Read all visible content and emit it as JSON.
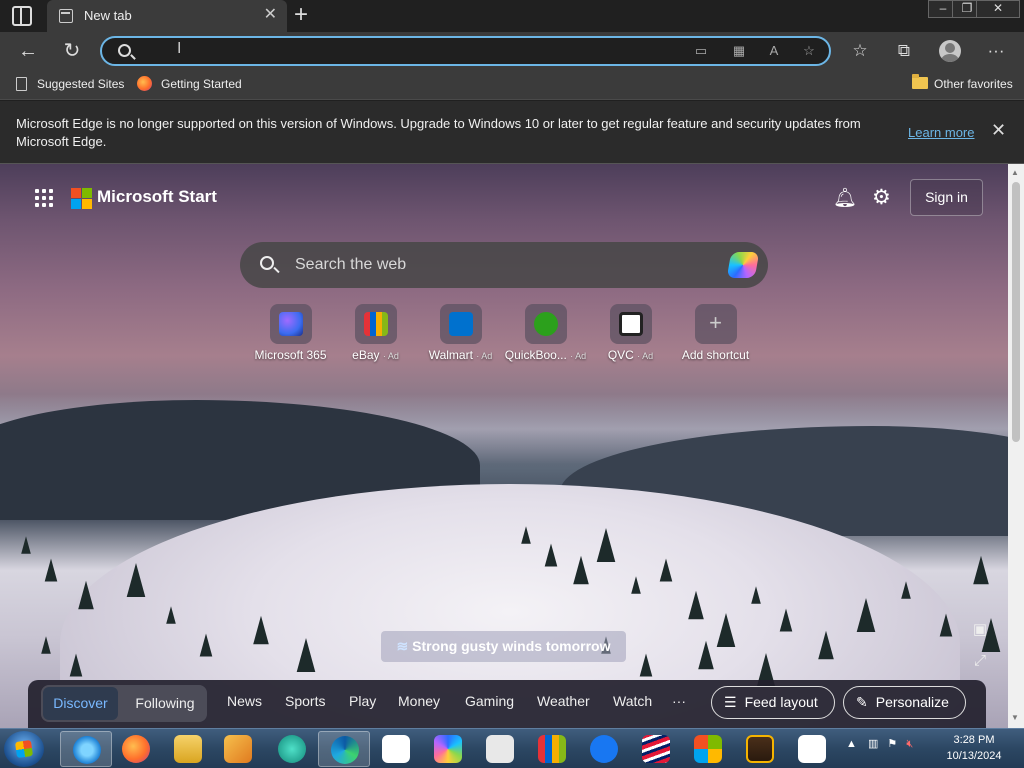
{
  "browser": {
    "tab": {
      "title": "New tab"
    },
    "address": {
      "value": "",
      "placeholder": ""
    },
    "favorites": [
      {
        "label": "Suggested Sites"
      },
      {
        "label": "Getting Started"
      }
    ],
    "other_favorites": "Other favorites"
  },
  "infobar": {
    "message": "Microsoft Edge is no longer supported on this version of Windows. Upgrade to Windows 10 or later to get regular feature and security updates from Microsoft Edge.",
    "link": "Learn more"
  },
  "start": {
    "brand": "Microsoft Start",
    "signin": "Sign in",
    "search_placeholder": "Search the web",
    "shortcuts": [
      {
        "label": "Microsoft 365",
        "ad": "",
        "color": "#5b5bd6"
      },
      {
        "label": "eBay",
        "ad": "· Ad",
        "color": "#e53238"
      },
      {
        "label": "Walmart",
        "ad": "· Ad",
        "color": "#0071ce"
      },
      {
        "label": "QuickBoo...",
        "ad": "· Ad",
        "color": "#2ca01c"
      },
      {
        "label": "QVC",
        "ad": "· Ad",
        "color": "#ffffff"
      },
      {
        "label": "Add shortcut",
        "ad": "",
        "color": "#777777"
      }
    ],
    "weather": "Strong gusty winds tomorrow",
    "feed": {
      "tabs": [
        "Discover",
        "Following"
      ],
      "links": [
        "News",
        "Sports",
        "Play",
        "Money",
        "Gaming",
        "Weather",
        "Watch",
        "···"
      ],
      "feed_layout": "Feed layout",
      "personalize": "Personalize"
    }
  },
  "taskbar": {
    "time": "3:28 PM",
    "date": "10/13/2024"
  }
}
